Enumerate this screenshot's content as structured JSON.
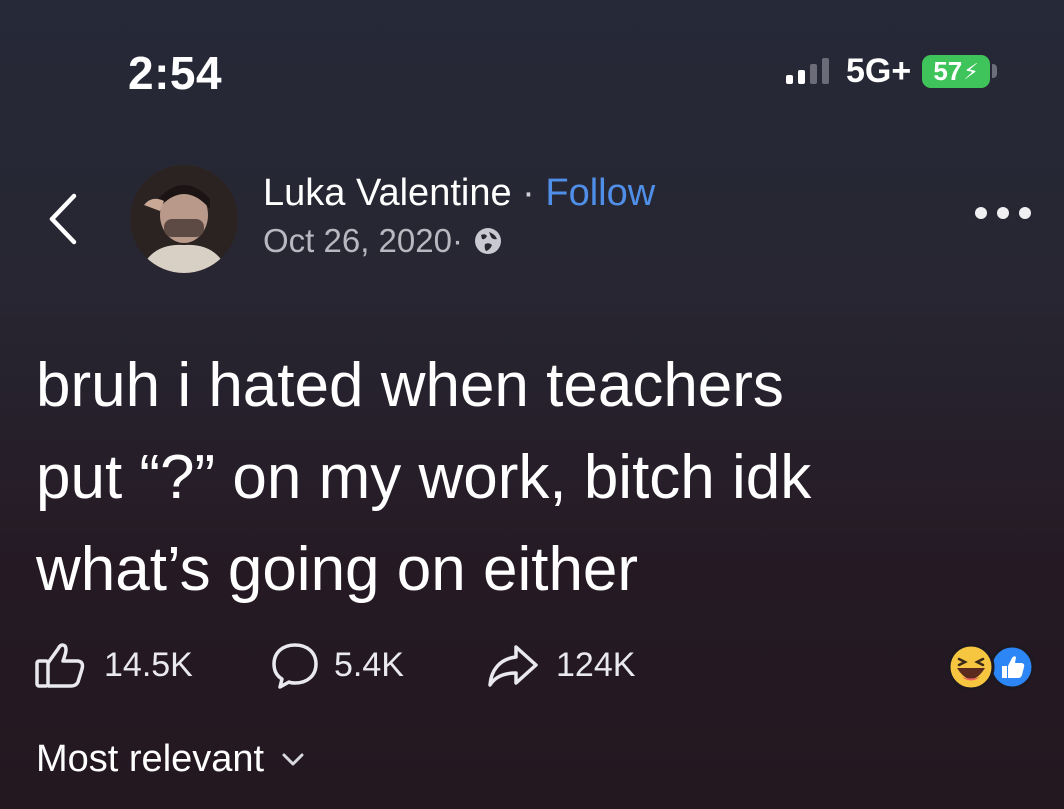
{
  "status_bar": {
    "time": "2:54",
    "network": "5G+",
    "battery": "57",
    "signal_bars_active": 2,
    "signal_bars_total": 4,
    "battery_color": "#3ec45a"
  },
  "post": {
    "author": "Luka Valentine",
    "separator": " · ",
    "follow_label": "Follow",
    "date": "Oct 26, 2020",
    "date_separator": " · ",
    "audience_icon": "globe-icon",
    "text_lines": [
      "bruh i hated when teachers",
      "put “?” on my work, bitch idk",
      "what’s going on either"
    ]
  },
  "stats": {
    "likes": "14.5K",
    "comments": "5.4K",
    "shares": "124K",
    "reaction_icons": [
      "haha-reaction-icon",
      "like-reaction-icon"
    ]
  },
  "comments_sort": {
    "label": "Most relevant"
  },
  "colors": {
    "accent": "#4f8fe8",
    "background_top": "#262938",
    "background_bottom": "#231820"
  }
}
